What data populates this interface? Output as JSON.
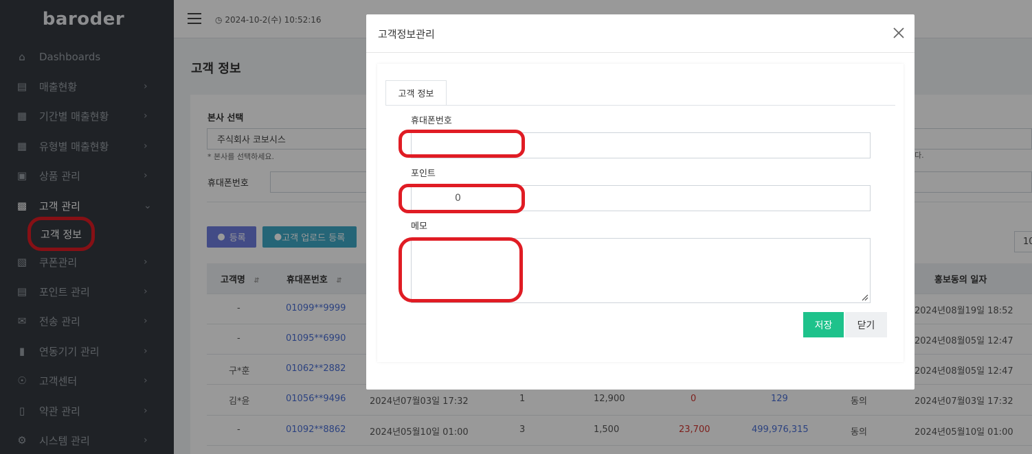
{
  "app": {
    "logo": "baroder"
  },
  "topbar": {
    "datetime": "2024-10-2(수) 10:52:16"
  },
  "sidebar": {
    "items": [
      {
        "label": "Dashboards",
        "icon": "home-icon"
      },
      {
        "label": "매출현황",
        "icon": "wallet-icon"
      },
      {
        "label": "기간별 매출현황",
        "icon": "bar-chart-icon"
      },
      {
        "label": "유형별 매출현황",
        "icon": "bar-chart-icon"
      },
      {
        "label": "상품 관리",
        "icon": "store-icon"
      },
      {
        "label": "고객 관리",
        "icon": "contact-card-icon"
      },
      {
        "label": "쿠폰관리",
        "icon": "ticket-icon"
      },
      {
        "label": "포인트 관리",
        "icon": "wallet-icon"
      },
      {
        "label": "전송 관리",
        "icon": "mail-icon"
      },
      {
        "label": "연동기기 관리",
        "icon": "device-icon"
      },
      {
        "label": "고객센터",
        "icon": "headset-icon"
      },
      {
        "label": "약관 관리",
        "icon": "book-icon"
      },
      {
        "label": "시스템 관리",
        "icon": "gear-icon"
      }
    ],
    "sub_active": "고객 정보"
  },
  "page": {
    "title": "고객 정보",
    "hq_label": "본사 선택",
    "hq_value": "주식회사 코보시스",
    "hq_hint": "* 본사를 선택하세요.",
    "hint_tail": "다.",
    "phone_label": "휴대폰번호",
    "register_button": "등록",
    "upload_button": "고객 업로드 등록",
    "page_size": "10",
    "table": {
      "headers": {
        "name": "고객명",
        "phone": "휴대폰번호",
        "promo_date": "홍보동의 일자"
      },
      "rows": [
        {
          "name": "-",
          "phone": "01099**9999",
          "date": "",
          "count": "",
          "amount": "",
          "used": "",
          "points": "",
          "consent": "",
          "promo_date": "2024년08월19일 18:52"
        },
        {
          "name": "-",
          "phone": "01095**6990",
          "date": "",
          "count": "",
          "amount": "",
          "used": "",
          "points": "",
          "consent": "",
          "promo_date": "2024년08월05일 12:47"
        },
        {
          "name": "구*훈",
          "phone": "01062**2882",
          "date": "",
          "count": "",
          "amount": "",
          "used": "",
          "points": "",
          "consent": "",
          "promo_date": "2024년08월05일 12:47"
        },
        {
          "name": "김*윤",
          "phone": "01056**9496",
          "date": "2024년07월03일 17:32",
          "count": "1",
          "amount": "12,900",
          "used": "0",
          "points": "129",
          "consent": "동의",
          "promo_date": "2024년07월03일 17:32"
        },
        {
          "name": "-",
          "phone": "01092**8862",
          "date": "2024년05월10일 01:00",
          "count": "3",
          "amount": "1,500",
          "used": "23,700",
          "points": "499,976,315",
          "consent": "동의",
          "promo_date": "2024년05월10일 01:00"
        }
      ]
    }
  },
  "modal": {
    "title": "고객정보관리",
    "tab": "고객 정보",
    "phone_label": "휴대폰번호",
    "phone_value": "",
    "point_label": "포인트",
    "point_value": "0",
    "memo_label": "메모",
    "memo_value": "",
    "save_button": "저장",
    "close_button": "닫기"
  },
  "colors": {
    "sidebar_bg": "#343a40",
    "accent_btn": "#1ec28b",
    "highlight": "#e01c24",
    "register_btn": "#6f7ee0",
    "upload_btn": "#3fa9c6"
  }
}
